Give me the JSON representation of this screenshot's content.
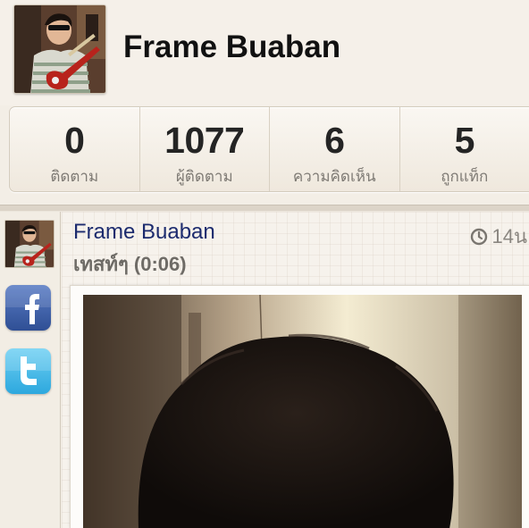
{
  "profile": {
    "name": "Frame Buaban"
  },
  "stats": [
    {
      "value": "0",
      "label": "ติดตาม"
    },
    {
      "value": "1077",
      "label": "ผู้ติดตาม"
    },
    {
      "value": "6",
      "label": "ความคิดเห็น"
    },
    {
      "value": "5",
      "label": "ถูกแท็ก"
    }
  ],
  "post": {
    "author": "Frame Buaban",
    "time": "14น",
    "caption": "เทสท์ๆ",
    "duration": "(0:06)"
  },
  "share": {
    "facebook_icon": "facebook-icon",
    "twitter_icon": "twitter-icon"
  },
  "colors": {
    "background": "#f3eee6",
    "author_link": "#1c2b6e",
    "facebook": "#3b5998",
    "twitter": "#2da8de"
  }
}
